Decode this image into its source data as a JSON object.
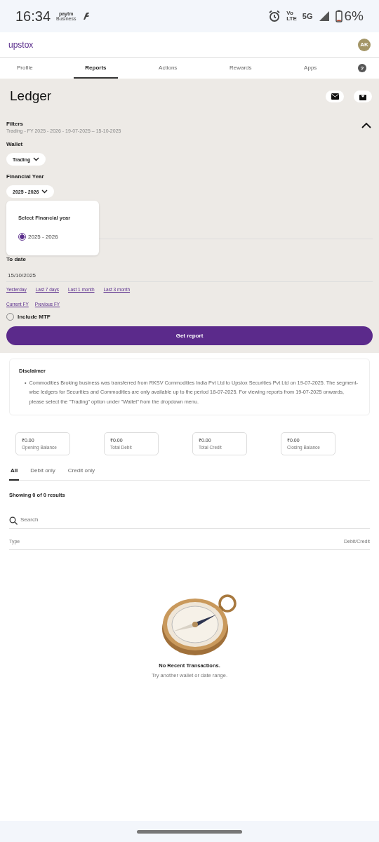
{
  "status_bar": {
    "time": "16:34",
    "paytm": "paytm",
    "paytm_sub": "Business",
    "volte": "Vo",
    "lte": "LTE",
    "network": "5G",
    "battery": "6%"
  },
  "header": {
    "logo": "upstox",
    "avatar": "AK"
  },
  "nav_tabs": [
    {
      "label": "Profile",
      "selected": false
    },
    {
      "label": "Reports",
      "selected": true
    },
    {
      "label": "Actions",
      "selected": false
    },
    {
      "label": "Rewards",
      "selected": false
    },
    {
      "label": "Apps",
      "selected": false
    }
  ],
  "help": "?",
  "page": {
    "title": "Ledger"
  },
  "filters": {
    "title": "Filters",
    "summary": "Trading - FY 2025 - 2026 - 19-07-2025 – 15-10-2025",
    "expanded": true,
    "wallet_label": "Wallet",
    "wallet_value": "Trading",
    "fy_label": "Financial Year",
    "fy_value": "2025 - 2026",
    "fy_popup": {
      "title": "Select Financial year",
      "options": [
        {
          "label": "2025 - 2026",
          "selected": true
        }
      ]
    },
    "to_date_label": "To date",
    "to_date_value": "15/10/2025",
    "quick_ranges": [
      [
        "Yesterday",
        "Last 7 days",
        "Last 1 month",
        "Last 3 month"
      ],
      [
        "Current FY",
        "Previous FY"
      ]
    ],
    "include_mtf": {
      "label": "Include MTF",
      "checked": false
    },
    "submit": "Get report"
  },
  "disclaimer": {
    "title": "Disclaimer",
    "bullet": "•",
    "items": [
      "Commodities Broking business was transferred from RKSV Commodities India Pvt Ltd to Upstox Securities Pvt Ltd on 19-07-2025. The segment-wise ledgers for Securities and Commodities are only available up to the period 18-07-2025. For viewing reports from 19-07-2025 onwards, please select the \"Trading\" option under \"Wallet\" from the dropdown menu."
    ]
  },
  "summary_cards": [
    {
      "value": "₹0.00",
      "label": "Opening Balance"
    },
    {
      "value": "₹0.00",
      "label": "Total Debit"
    },
    {
      "value": "₹0.00",
      "label": "Total Credit"
    },
    {
      "value": "₹0.00",
      "label": "Closing Balance"
    }
  ],
  "ledger_tabs": [
    {
      "label": "All",
      "selected": true
    },
    {
      "label": "Debit only",
      "selected": false
    },
    {
      "label": "Credit only",
      "selected": false
    }
  ],
  "results": "Showing 0 of 0 results",
  "search": {
    "placeholder": "Search"
  },
  "table": {
    "columns": [
      "Type",
      "Debit/Credit"
    ]
  },
  "empty_state": {
    "title": "No Recent Transactions.",
    "subtitle": "Try another wallet or date range."
  }
}
